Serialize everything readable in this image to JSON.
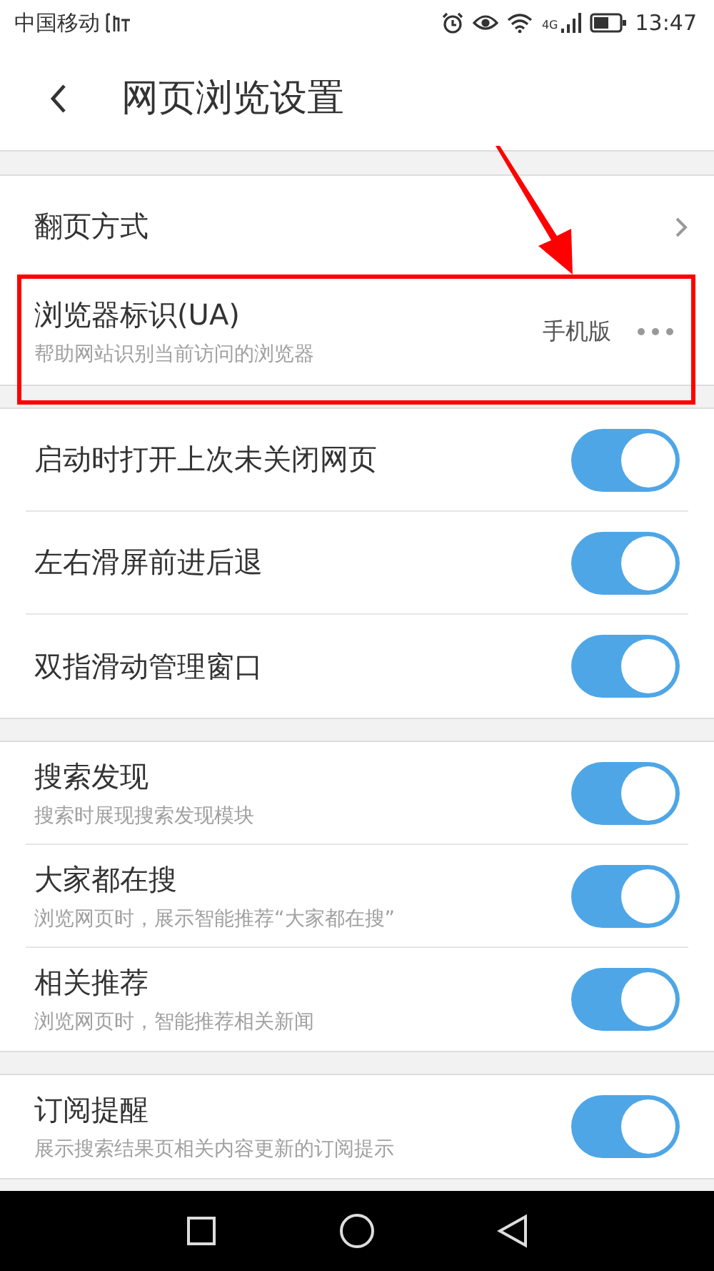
{
  "status_bar": {
    "carrier": "中国移动",
    "network": "4G",
    "time": "13:47"
  },
  "header": {
    "title": "网页浏览设置"
  },
  "groups": [
    {
      "rows": [
        {
          "kind": "nav",
          "title": "翻页方式",
          "highlighted": false
        },
        {
          "kind": "value",
          "title": "浏览器标识(UA)",
          "subtitle": "帮助网站识别当前访问的浏览器",
          "value": "手机版",
          "highlighted": true
        }
      ]
    },
    {
      "rows": [
        {
          "kind": "toggle",
          "title": "启动时打开上次未关闭网页",
          "on": true
        },
        {
          "kind": "toggle",
          "title": "左右滑屏前进后退",
          "on": true
        },
        {
          "kind": "toggle",
          "title": "双指滑动管理窗口",
          "on": true
        }
      ]
    },
    {
      "rows": [
        {
          "kind": "toggle",
          "title": "搜索发现",
          "subtitle": "搜索时展现搜索发现模块",
          "on": true
        },
        {
          "kind": "toggle",
          "title": "大家都在搜",
          "subtitle": "浏览网页时，展示智能推荐“大家都在搜”",
          "on": true
        },
        {
          "kind": "toggle",
          "title": "相关推荐",
          "subtitle": "浏览网页时，智能推荐相关新闻",
          "on": true
        }
      ]
    },
    {
      "rows": [
        {
          "kind": "toggle",
          "title": "订阅提醒",
          "subtitle": "展示搜索结果页相关内容更新的订阅提示",
          "on": true
        }
      ]
    }
  ]
}
